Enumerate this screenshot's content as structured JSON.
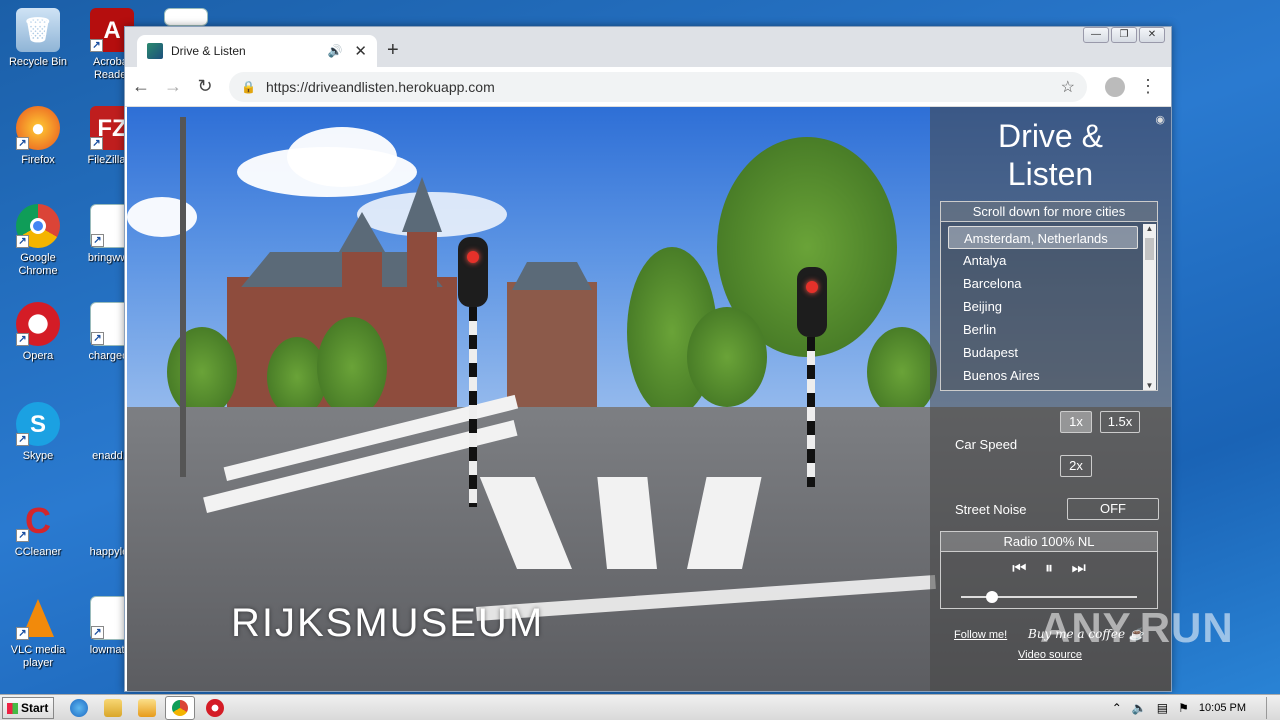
{
  "desktop": {
    "icons": [
      {
        "label": "Recycle Bin"
      },
      {
        "label": "Acrobat Reader"
      },
      {
        "label": "Firefox"
      },
      {
        "label": "FileZilla C"
      },
      {
        "label": "Google Chrome"
      },
      {
        "label": "bringwww"
      },
      {
        "label": "Opera"
      },
      {
        "label": "chargeciv"
      },
      {
        "label": "Skype"
      },
      {
        "label": "enadd.p"
      },
      {
        "label": "CCleaner"
      },
      {
        "label": "happylea"
      },
      {
        "label": "VLC media player"
      },
      {
        "label": "lowmatur"
      }
    ]
  },
  "browser": {
    "tab_title": "Drive & Listen",
    "new_tab": "+",
    "url": "https://driveandlisten.herokuapp.com"
  },
  "video": {
    "place_caption": "RIJKSMUSEUM"
  },
  "panel": {
    "title": "Drive & Listen",
    "city_header": "Scroll down for more cities",
    "cities": [
      {
        "label": "Amsterdam, Netherlands"
      },
      {
        "label": "Antalya"
      },
      {
        "label": "Barcelona"
      },
      {
        "label": "Beijing"
      },
      {
        "label": "Berlin"
      },
      {
        "label": "Budapest"
      },
      {
        "label": "Buenos Aires"
      }
    ],
    "car_speed_label": "Car Speed",
    "speed_options": {
      "s1": "1x",
      "s15": "1.5x",
      "s2": "2x"
    },
    "street_noise_label": "Street Noise",
    "street_noise_value": "OFF",
    "radio_name": "Radio 100% NL",
    "volume": 0.14,
    "follow_link": "Follow me!",
    "coffee_text": "Buy me a coffee",
    "video_source_link": "Video source"
  },
  "watermark": "ANY.RUN",
  "taskbar": {
    "start_label": "Start",
    "clock": "10:05 PM"
  }
}
